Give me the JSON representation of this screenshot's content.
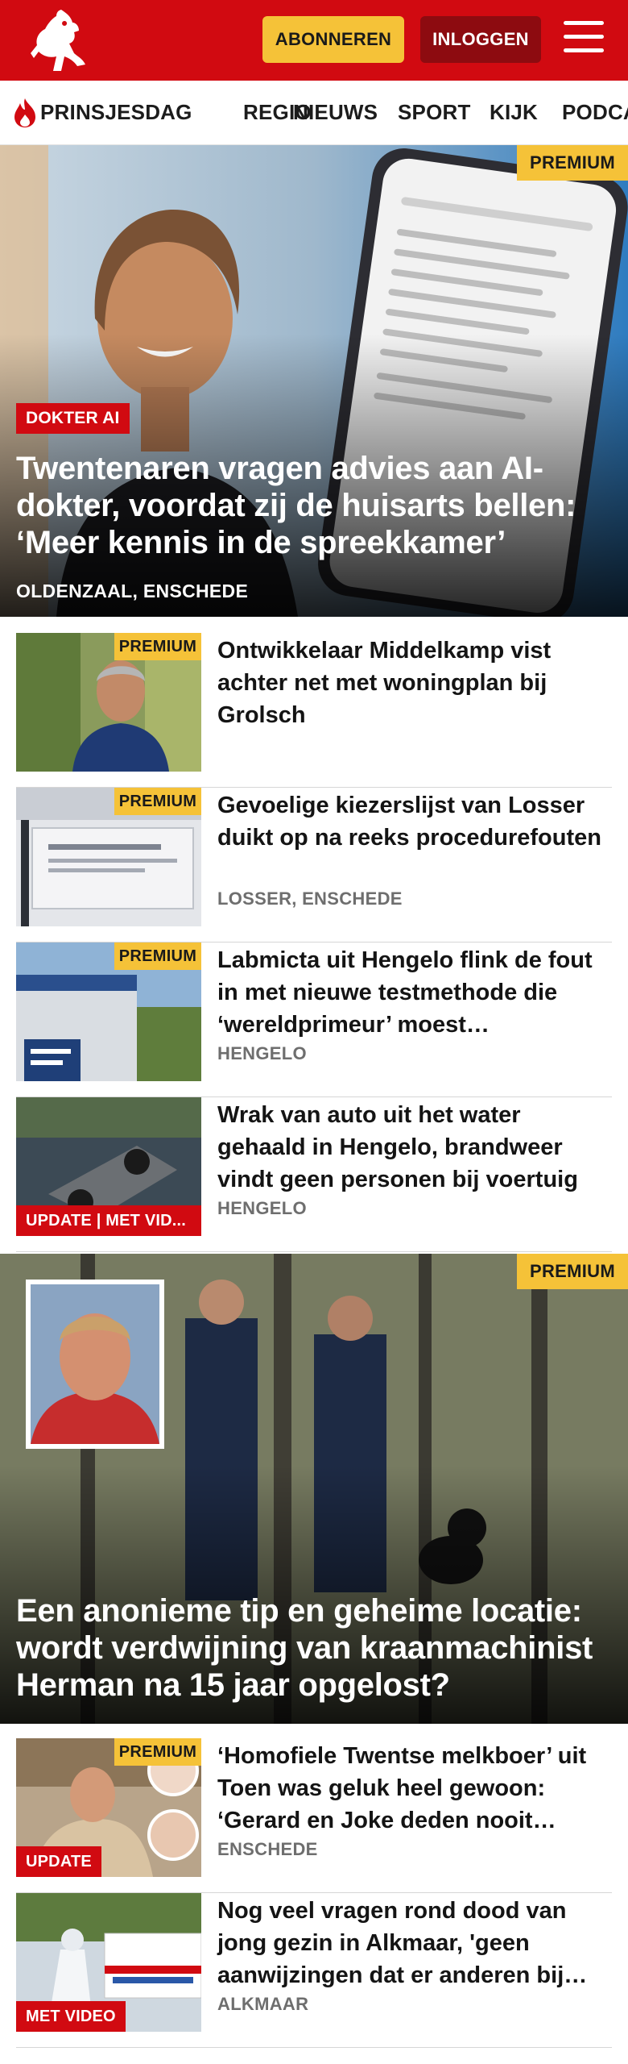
{
  "header": {
    "subscribe_label": "ABONNEREN",
    "login_label": "INLOGGEN"
  },
  "nav": {
    "items": [
      "PRINSJESDAG",
      "REGIO",
      "NIEUWS",
      "SPORT",
      "KIJK",
      "PODCAST"
    ]
  },
  "colors": {
    "brand_red": "#d10a11",
    "premium_yellow": "#f5c238",
    "login_dark_red": "#8d0b10"
  },
  "hero": {
    "badge": "PREMIUM",
    "tag": "DOKTER AI",
    "title": "Twentenaren vragen advies aan AI-dokter, voordat zij de huisarts bellen: ‘Meer kennis in de spreekkamer’",
    "location": "OLDENZAAL, ENSCHEDE"
  },
  "articles": [
    {
      "badge": "PREMIUM",
      "title": "Ontwikkelaar Middelkamp vist achter net met woningplan bij Grolsch",
      "location": ""
    },
    {
      "badge": "PREMIUM",
      "title": "Gevoelige kiezerslijst van Losser duikt op na reeks procedurefouten",
      "location": "LOSSER, ENSCHEDE"
    },
    {
      "badge": "PREMIUM",
      "title": "Labmicta uit Hengelo flink de fout in met nieuwe testmethode die ‘wereldprimeur’ moest…",
      "location": "HENGELO"
    },
    {
      "tag": "UPDATE | MET VID...",
      "title": "Wrak van auto uit het water gehaald in Hengelo, brandweer vindt geen personen bij voertuig",
      "location": "HENGELO"
    }
  ],
  "feature": {
    "badge": "PREMIUM",
    "title": "Een anonieme tip en geheime locatie: wordt verdwijning van kraanmachinist Herman na 15 jaar opgelost?"
  },
  "articles2": [
    {
      "badge": "PREMIUM",
      "tag": "UPDATE",
      "title": "‘Homofiele Twentse melkboer’ uit Toen was geluk heel gewoon: ‘Gerard en Joke deden nooit…",
      "location": "ENSCHEDE"
    },
    {
      "tag": "MET VIDEO",
      "title": "Nog veel vragen rond dood van jong gezin in Alkmaar, 'geen aanwijzingen dat er anderen bij…",
      "location": "ALKMAAR"
    }
  ]
}
